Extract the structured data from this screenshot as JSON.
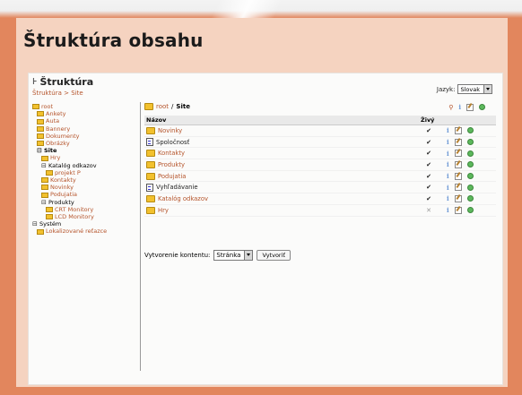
{
  "page_title": "Štruktúra obsahu",
  "header": {
    "icon": "tree-icon",
    "title": "Štruktúra",
    "breadcrumb": [
      "Štruktúra",
      ">",
      "Site"
    ]
  },
  "language": {
    "label": "Jazyk:",
    "selected": "Slovak"
  },
  "tree": [
    {
      "label": "root",
      "level": 0,
      "icon": "folder-icon"
    },
    {
      "label": "Ankety",
      "level": 1,
      "icon": "folder-icon"
    },
    {
      "label": "Auta",
      "level": 1,
      "icon": "folder-icon"
    },
    {
      "label": "Bannery",
      "level": 1,
      "icon": "folder-icon"
    },
    {
      "label": "Dokumenty",
      "level": 1,
      "icon": "folder-icon"
    },
    {
      "label": "Obrázky",
      "level": 1,
      "icon": "folder-icon"
    },
    {
      "label": "Site",
      "level": 1,
      "expander": "⊟",
      "bold": true
    },
    {
      "label": "Hry",
      "level": 2,
      "icon": "folder-icon"
    },
    {
      "label": "Katalóg odkazov",
      "level": 2,
      "expander": "⊟"
    },
    {
      "label": "projekt P",
      "level": 3,
      "icon": "folder-icon"
    },
    {
      "label": "Kontakty",
      "level": 2,
      "icon": "folder-icon"
    },
    {
      "label": "Novinky",
      "level": 2,
      "icon": "folder-icon"
    },
    {
      "label": "Podujatia",
      "level": 2,
      "icon": "folder-icon"
    },
    {
      "label": "Produkty",
      "level": 2,
      "expander": "⊟"
    },
    {
      "label": "CRT Monitory",
      "level": 3,
      "icon": "folder-icon"
    },
    {
      "label": "LCD Monitory",
      "level": 3,
      "icon": "folder-icon"
    },
    {
      "label": "Systém",
      "level": 0,
      "expander": "⊟"
    },
    {
      "label": "Lokalizované reťazce",
      "level": 1,
      "icon": "folder-icon"
    }
  ],
  "main": {
    "path_root": "root",
    "path_sep": "/",
    "path_current": "Site",
    "columns": {
      "name": "Názov",
      "live": "Živý"
    },
    "rows": [
      {
        "name": "Novinky",
        "type": "folder",
        "live": "✔"
      },
      {
        "name": "Spoločnosť",
        "type": "page",
        "live": "✔"
      },
      {
        "name": "Kontakty",
        "type": "folder",
        "live": "✔"
      },
      {
        "name": "Produkty",
        "type": "folder",
        "live": "✔"
      },
      {
        "name": "Podujatia",
        "type": "folder",
        "live": "✔"
      },
      {
        "name": "Vyhľadávanie",
        "type": "page",
        "live": "✔"
      },
      {
        "name": "Katalóg odkazov",
        "type": "folder",
        "live": "✔"
      },
      {
        "name": "Hry",
        "type": "folder",
        "live": "✕"
      }
    ],
    "create": {
      "label": "Vytvorenie kontentu:",
      "selected": "Stránka",
      "button": "Vytvoriť"
    }
  },
  "colors": {
    "accent": "#b5542b",
    "background": "#e2865d",
    "frame": "#f5d3c0"
  }
}
